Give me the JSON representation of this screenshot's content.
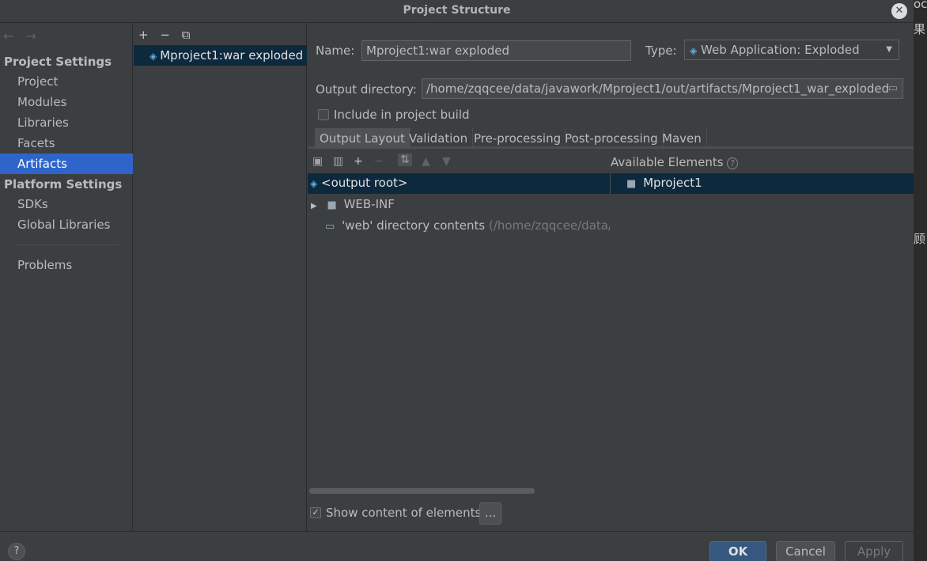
{
  "window": {
    "title": "Project Structure",
    "close_glyph": "✕"
  },
  "background_strip": {
    "chars": [
      "oc",
      "果",
      "顾"
    ]
  },
  "nav": {
    "back_icon": "←",
    "forward_icon": "→",
    "project_settings_heading": "Project Settings",
    "project_settings_items": [
      "Project",
      "Modules",
      "Libraries",
      "Facets",
      "Artifacts"
    ],
    "selected_item": "Artifacts",
    "platform_settings_heading": "Platform Settings",
    "platform_settings_items": [
      "SDKs",
      "Global Libraries"
    ],
    "problems_label": "Problems"
  },
  "artifacts": {
    "toolbar": {
      "add": "+",
      "remove": "−",
      "copy": "⧉"
    },
    "items": [
      {
        "label": "Mproject1:war exploded",
        "icon": "web-artifact-icon"
      }
    ]
  },
  "editor": {
    "name_label": "Name:",
    "name_value": "Mproject1:war exploded",
    "type_label": "Type:",
    "type_value": "Web Application: Exploded",
    "output_dir_label": "Output directory:",
    "output_dir_value": "/home/zqqcee/data/javawork/Mproject1/out/artifacts/Mproject1_war_exploded",
    "include_in_build_label": "Include in project build",
    "include_in_build_checked": false,
    "tabs": [
      "Output Layout",
      "Validation",
      "Pre-processing",
      "Post-processing",
      "Maven"
    ],
    "active_tab": "Output Layout",
    "available_elements_label": "Available Elements",
    "layout_tree": [
      {
        "label": "<output root>",
        "icon": "artifact-root-icon",
        "selected": true
      },
      {
        "label": "WEB-INF",
        "icon": "folder-icon",
        "expandable": true
      },
      {
        "label": "'web' directory contents",
        "suffix": "(/home/zqqcee/data/java",
        "icon": "folder-icon"
      }
    ],
    "available_tree": [
      {
        "label": "Mproject1",
        "icon": "module-folder-icon"
      }
    ],
    "show_content_label": "Show content of elements",
    "show_content_checked": true,
    "more_button_label": "..."
  },
  "footer": {
    "help_label": "?",
    "ok_label": "OK",
    "cancel_label": "Cancel",
    "apply_label": "Apply"
  },
  "colors": {
    "background": "#3c3f41",
    "selection": "#2f65ca",
    "tree_selection": "#0d293e",
    "ok_button": "#365880"
  }
}
